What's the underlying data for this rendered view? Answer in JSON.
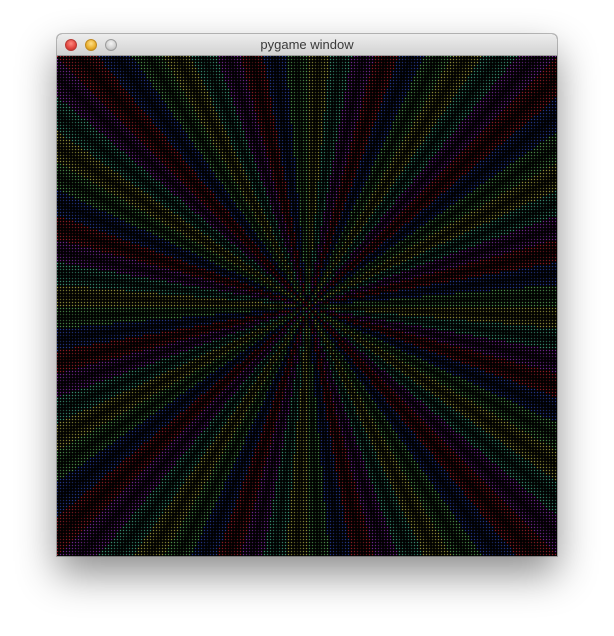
{
  "window": {
    "title": "pygame window",
    "controls": {
      "close": "close-icon",
      "minimize": "minimize-icon",
      "zoom": "zoom-icon"
    }
  },
  "pattern": {
    "background": "#000000",
    "colors": [
      "#ffff66",
      "#66ffcc",
      "#cc44ff",
      "#ff3344",
      "#4466ff",
      "#88ff88"
    ],
    "ray_count": 72,
    "dot_spacing": 3
  }
}
